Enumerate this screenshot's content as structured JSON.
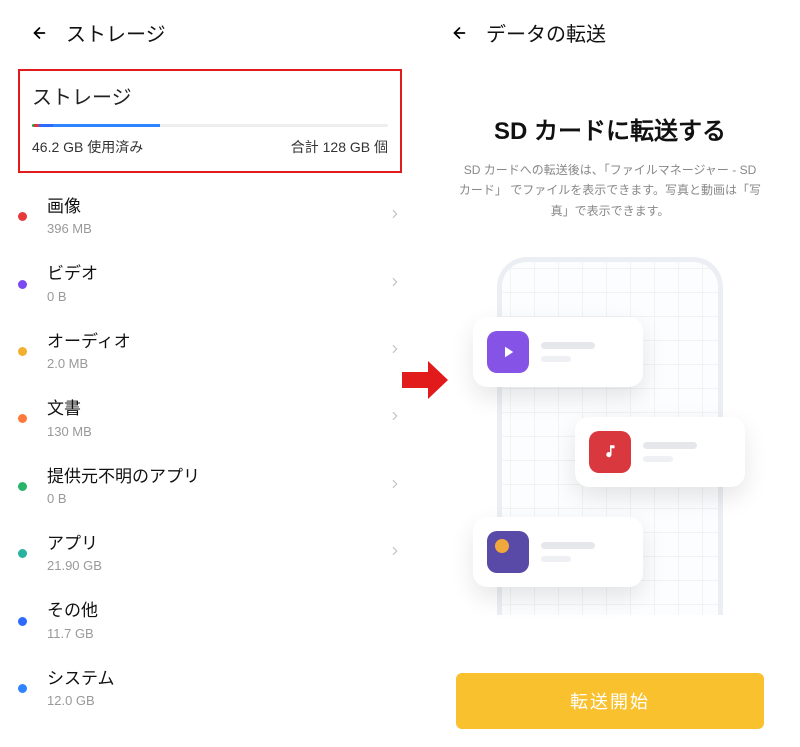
{
  "left": {
    "header_title": "ストレージ",
    "box_title": "ストレージ",
    "used_text": "46.2 GB 使用済み",
    "total_text": "合計 128 GB 個",
    "bar_segments": [
      {
        "width": 0.5,
        "color": "#22a53a"
      },
      {
        "width": 1.5,
        "color": "#d9383e"
      },
      {
        "width": 4,
        "color": "#2e69ff"
      },
      {
        "width": 30,
        "color": "#2e84ff"
      }
    ],
    "items": [
      {
        "label": "画像",
        "size": "396 MB",
        "color": "#e63a3a",
        "chevron": true
      },
      {
        "label": "ビデオ",
        "size": "0 B",
        "color": "#7a4af0",
        "chevron": true
      },
      {
        "label": "オーディオ",
        "size": "2.0 MB",
        "color": "#f2b02e",
        "chevron": true
      },
      {
        "label": "文書",
        "size": "130 MB",
        "color": "#ff7a3a",
        "chevron": true
      },
      {
        "label": "提供元不明のアプリ",
        "size": "0 B",
        "color": "#27b36a",
        "chevron": true
      },
      {
        "label": "アプリ",
        "size": "21.90  GB",
        "color": "#27b3a0",
        "chevron": true
      },
      {
        "label": "その他",
        "size": "11.7 GB",
        "color": "#2e69ff",
        "chevron": false
      },
      {
        "label": "システム",
        "size": "12.0 GB",
        "color": "#2e84ff",
        "chevron": false
      }
    ]
  },
  "right": {
    "header_title": "データの転送",
    "title": "SD カードに転送する",
    "desc_1": "SD カードへの転送後は、「ファイルマネージャー - SD",
    "desc_2": "カード」 でファイルを表示できます。写真と動画は「写",
    "desc_3": "真」で表示できます。",
    "start_label": "転送開始"
  },
  "colors": {
    "accent_arrow": "#e11b1b"
  }
}
